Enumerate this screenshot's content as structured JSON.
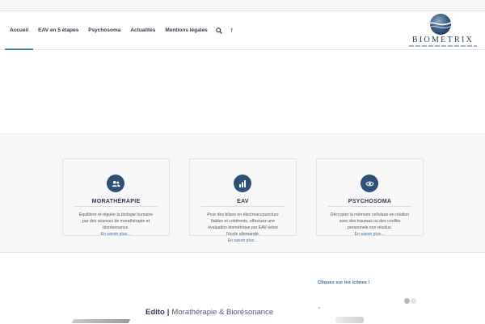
{
  "nav": {
    "items": [
      {
        "label": "Accueil",
        "active": true
      },
      {
        "label": "EAV en 5 étapes",
        "active": false
      },
      {
        "label": "Psychosoma",
        "active": false
      },
      {
        "label": "Actualités",
        "active": false
      },
      {
        "label": "Mentions légales",
        "active": false
      }
    ],
    "search_icon": "search-icon",
    "facebook_glyph": "f",
    "accent_color": "#4a7fa8"
  },
  "logo": {
    "name": "BIOMETRIX",
    "mark_icon": "globe-wave-icon"
  },
  "cards": [
    {
      "icon": "users-icon",
      "title": "MORATHÉRAPIE",
      "lines": [
        "Équilibrer et réguler la biologie humaine",
        "par des séances de morathérapie et",
        "biorésonance."
      ],
      "link": "En savoir plus…"
    },
    {
      "icon": "bar-chart-icon",
      "title": "EAV",
      "lines": [
        "Pour des bilans en électroacupuncture",
        "fiables et cohérents, effectuez une",
        "évaluation biométrique par EAV selon",
        "l'école allemande."
      ],
      "link": "En savoir plus…"
    },
    {
      "icon": "eye-icon",
      "title": "PSYCHOSOMA",
      "lines": [
        "Décrypter la mémoire cellulaire en relation",
        "avec des traumas ou des conflits",
        "personnels non résolus."
      ],
      "link": "En savoir plus…"
    }
  ],
  "bottom": {
    "click_hint": "Cliquez sur les icônes !",
    "edito_label": "Edito",
    "edito_separator": "|",
    "edito_title": "Morathérapie & Biorésonance",
    "slider": {
      "count": 2,
      "active_index": 0
    }
  },
  "colors": {
    "primary_dark": "#2c5277",
    "link": "#3f6e99",
    "text_dark": "#2e3b4e"
  }
}
